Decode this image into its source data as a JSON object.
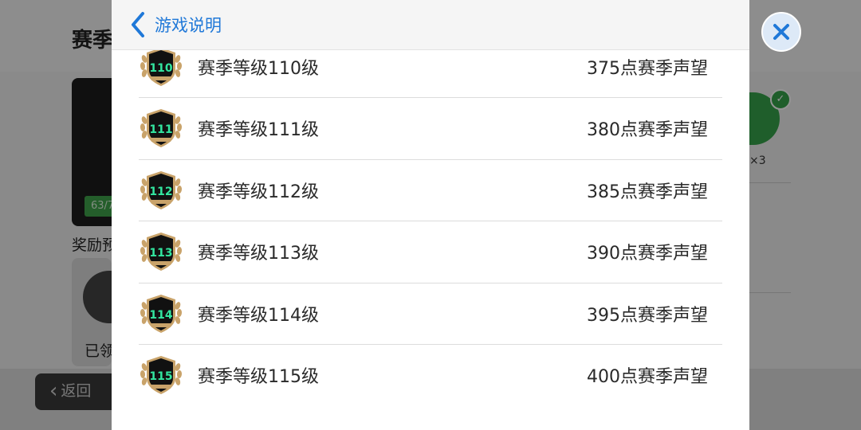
{
  "background": {
    "title": "赛季",
    "progress": "63/7",
    "section_label": "奖励预",
    "claimed_label": "已领",
    "back_label": "返回",
    "right_count": "×3"
  },
  "modal": {
    "back_label": "游戏说明",
    "rows": [
      {
        "badge": "110",
        "level": "赛季等级110级",
        "reward": "375点赛季声望"
      },
      {
        "badge": "111",
        "level": "赛季等级111级",
        "reward": "380点赛季声望"
      },
      {
        "badge": "112",
        "level": "赛季等级112级",
        "reward": "385点赛季声望"
      },
      {
        "badge": "113",
        "level": "赛季等级113级",
        "reward": "390点赛季声望"
      },
      {
        "badge": "114",
        "level": "赛季等级114级",
        "reward": "395点赛季声望"
      },
      {
        "badge": "115",
        "level": "赛季等级115级",
        "reward": "400点赛季声望"
      }
    ]
  },
  "colors": {
    "accent": "#1f78d8",
    "badge_green": "#33e6a0",
    "badge_gold": "#c9a36a",
    "badge_dark": "#111111"
  },
  "icons": {
    "close": "close-icon",
    "back": "chevron-left-icon",
    "badge": "level-badge-icon"
  }
}
